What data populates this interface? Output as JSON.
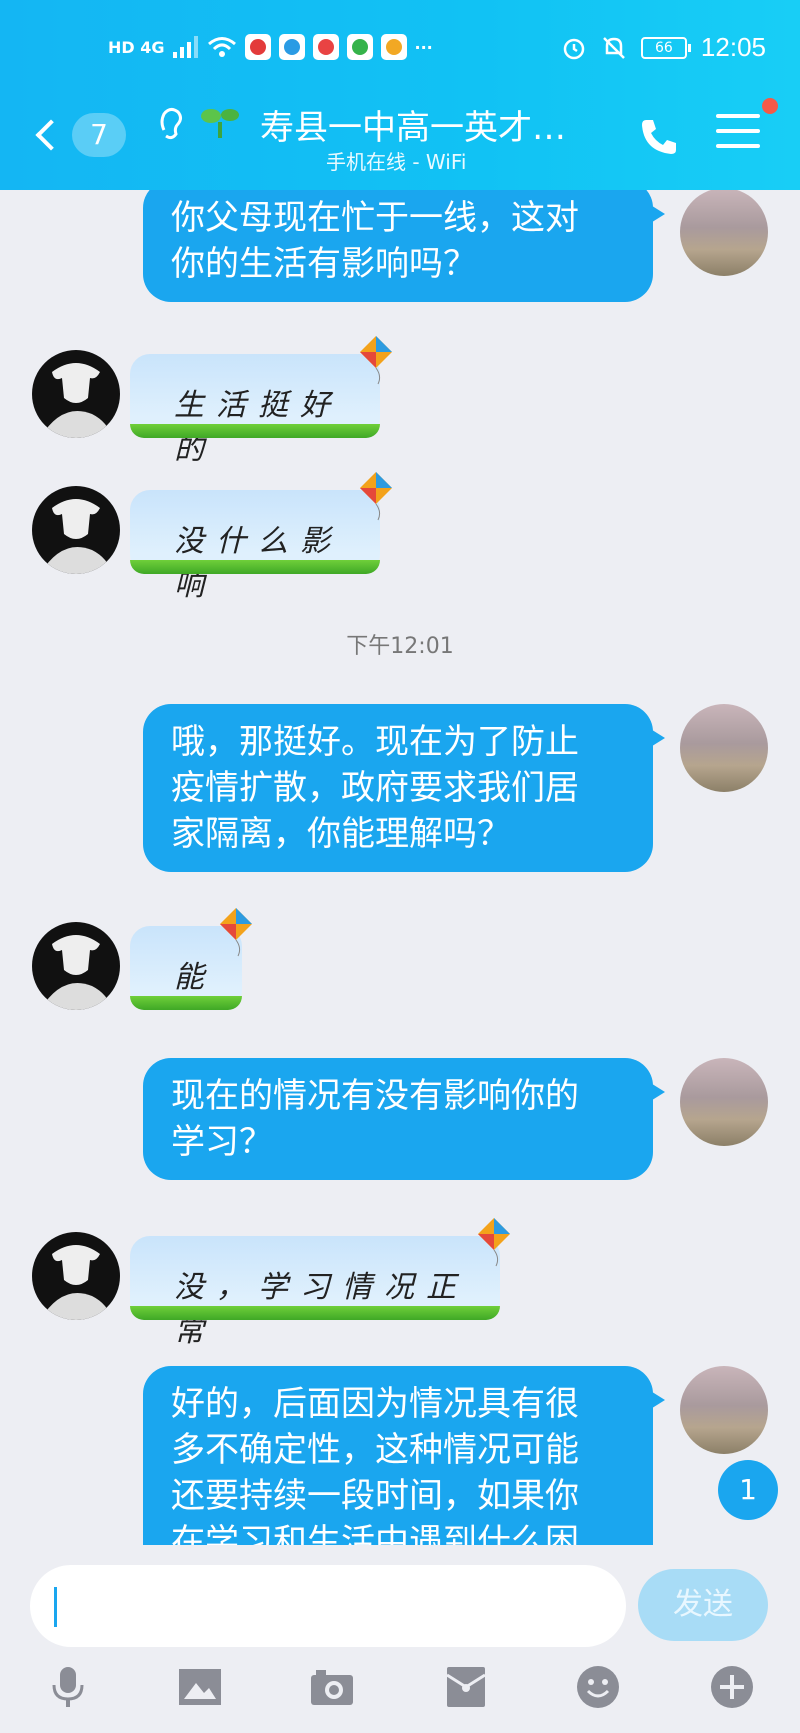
{
  "statusbar": {
    "left_indicators": "HD 4G",
    "battery": "66",
    "time": "12:05"
  },
  "header": {
    "back_count": "7",
    "title": "寿县一中高一英才…",
    "subtitle": "手机在线 - WiFi"
  },
  "messages": [
    {
      "from": "me",
      "text_lines": [
        "你父母现在忙于一线，这对",
        "你的生活有影响吗？"
      ]
    },
    {
      "from": "them",
      "text": "生活挺好的"
    },
    {
      "from": "them",
      "text": "没什么影响"
    },
    {
      "type": "time",
      "text": "下午12:01"
    },
    {
      "from": "me",
      "text_lines": [
        "哦，那挺好。现在为了防止",
        "疫情扩散，政府要求我们居",
        "家隔离，你能理解吗？"
      ]
    },
    {
      "from": "them",
      "text": "能"
    },
    {
      "from": "me",
      "text_lines": [
        "现在的情况有没有影响你的",
        "学习？"
      ]
    },
    {
      "from": "them",
      "text": "没，学习情况正常"
    },
    {
      "from": "me",
      "text_lines": [
        "好的，后面因为情况具有很",
        "多不确定性，这种情况可能",
        "还要持续一段时间，如果你",
        "在学习和生活中遇到什么困"
      ]
    }
  ],
  "unread_badge": "1",
  "input": {
    "value": "",
    "placeholder": ""
  },
  "send_label": "发送",
  "toolbar": {
    "icons": [
      "mic-icon",
      "image-icon",
      "camera-icon",
      "red-packet-icon",
      "emoji-icon",
      "plus-icon"
    ]
  },
  "colors": {
    "header": "#14b6f3",
    "bubble_me": "#1aa6ef",
    "bubble_them": "#dff0fd",
    "background": "#edeef3"
  }
}
